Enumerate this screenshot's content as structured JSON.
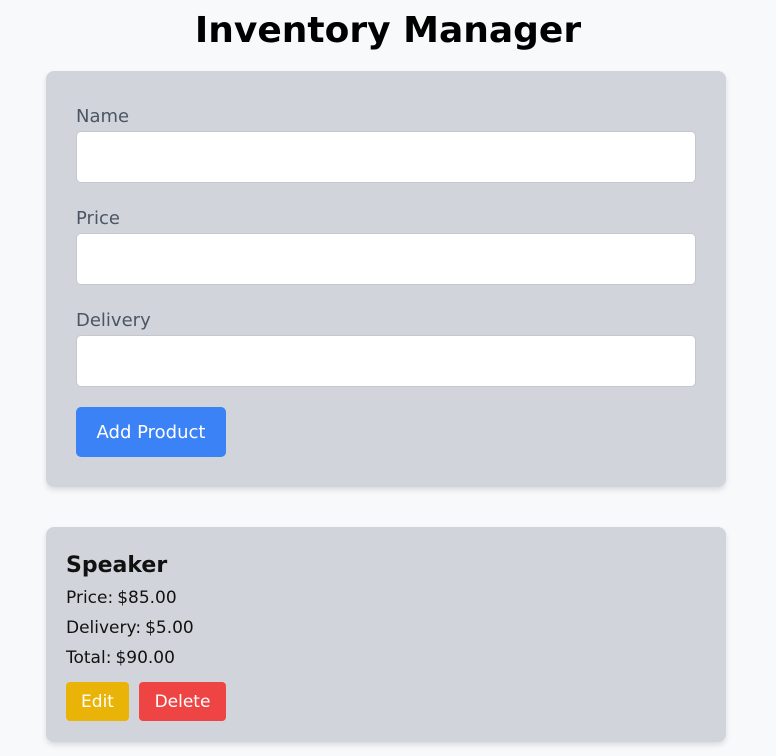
{
  "app": {
    "title": "Inventory Manager"
  },
  "form": {
    "fields": [
      {
        "label": "Name",
        "value": "",
        "placeholder": ""
      },
      {
        "label": "Price",
        "value": "",
        "placeholder": ""
      },
      {
        "label": "Delivery",
        "value": "",
        "placeholder": ""
      }
    ],
    "submit_label": "Add Product"
  },
  "products": [
    {
      "name": "Speaker",
      "price_label": "Price:",
      "price": "$85.00",
      "delivery_label": "Delivery:",
      "delivery": "$5.00",
      "total_label": "Total:",
      "total": "$90.00",
      "edit_label": "Edit",
      "delete_label": "Delete"
    }
  ],
  "colors": {
    "background": "#f8f9fb",
    "card": "#d1d5db",
    "primary": "#3b82f6",
    "edit": "#eab308",
    "delete": "#ef4444"
  }
}
